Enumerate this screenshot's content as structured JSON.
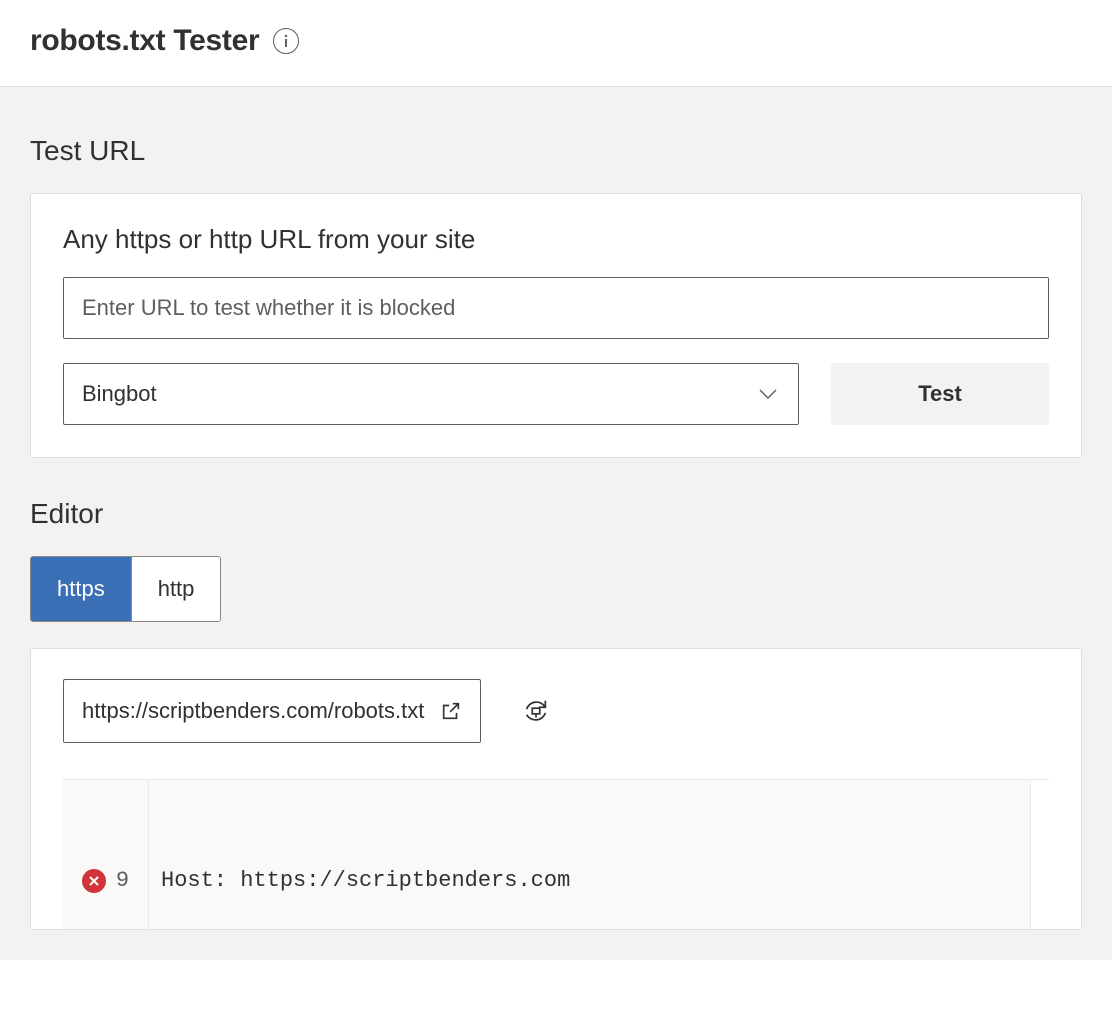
{
  "header": {
    "title": "robots.txt Tester"
  },
  "test_url": {
    "heading": "Test URL",
    "field_label": "Any https or http URL from your site",
    "input_placeholder": "Enter URL to test whether it is blocked",
    "select_value": "Bingbot",
    "test_button": "Test"
  },
  "editor": {
    "heading": "Editor",
    "tabs": {
      "https": "https",
      "http": "http",
      "active": "https"
    },
    "url": "https://scriptbenders.com/robots.txt",
    "code": {
      "visible_line_number": "9",
      "visible_line_text": "Host: https://scriptbenders.com",
      "has_error": true
    }
  }
}
